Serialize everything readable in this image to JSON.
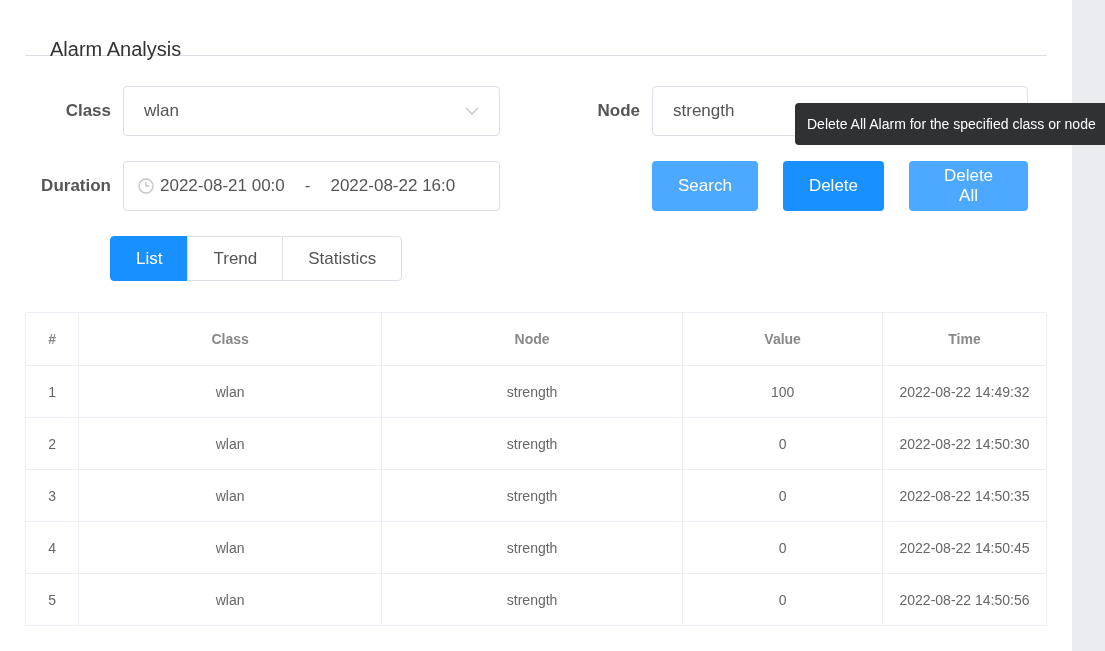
{
  "page": {
    "title": "Alarm Analysis"
  },
  "filters": {
    "class_label": "Class",
    "class_value": "wlan",
    "node_label": "Node",
    "node_value": "strength",
    "duration_label": "Duration",
    "duration_start": "2022-08-21 00:0",
    "duration_separator": "-",
    "duration_end": "2022-08-22 16:0"
  },
  "buttons": [
    {
      "label": "Search",
      "kind": "light"
    },
    {
      "label": "Delete",
      "kind": "solid"
    },
    {
      "label": "Delete All",
      "kind": "light"
    }
  ],
  "tooltip": {
    "text": "Delete All Alarm for the specified class or node"
  },
  "tabs": [
    {
      "label": "List",
      "selected": true
    },
    {
      "label": "Trend",
      "selected": false
    },
    {
      "label": "Statistics",
      "selected": false
    }
  ],
  "table": {
    "columns": [
      "#",
      "Class",
      "Node",
      "Value",
      "Time"
    ],
    "rows": [
      [
        "1",
        "wlan",
        "strength",
        "100",
        "2022-08-22 14:49:32"
      ],
      [
        "2",
        "wlan",
        "strength",
        "0",
        "2022-08-22 14:50:30"
      ],
      [
        "3",
        "wlan",
        "strength",
        "0",
        "2022-08-22 14:50:35"
      ],
      [
        "4",
        "wlan",
        "strength",
        "0",
        "2022-08-22 14:50:45"
      ],
      [
        "5",
        "wlan",
        "strength",
        "0",
        "2022-08-22 14:50:56"
      ]
    ]
  }
}
